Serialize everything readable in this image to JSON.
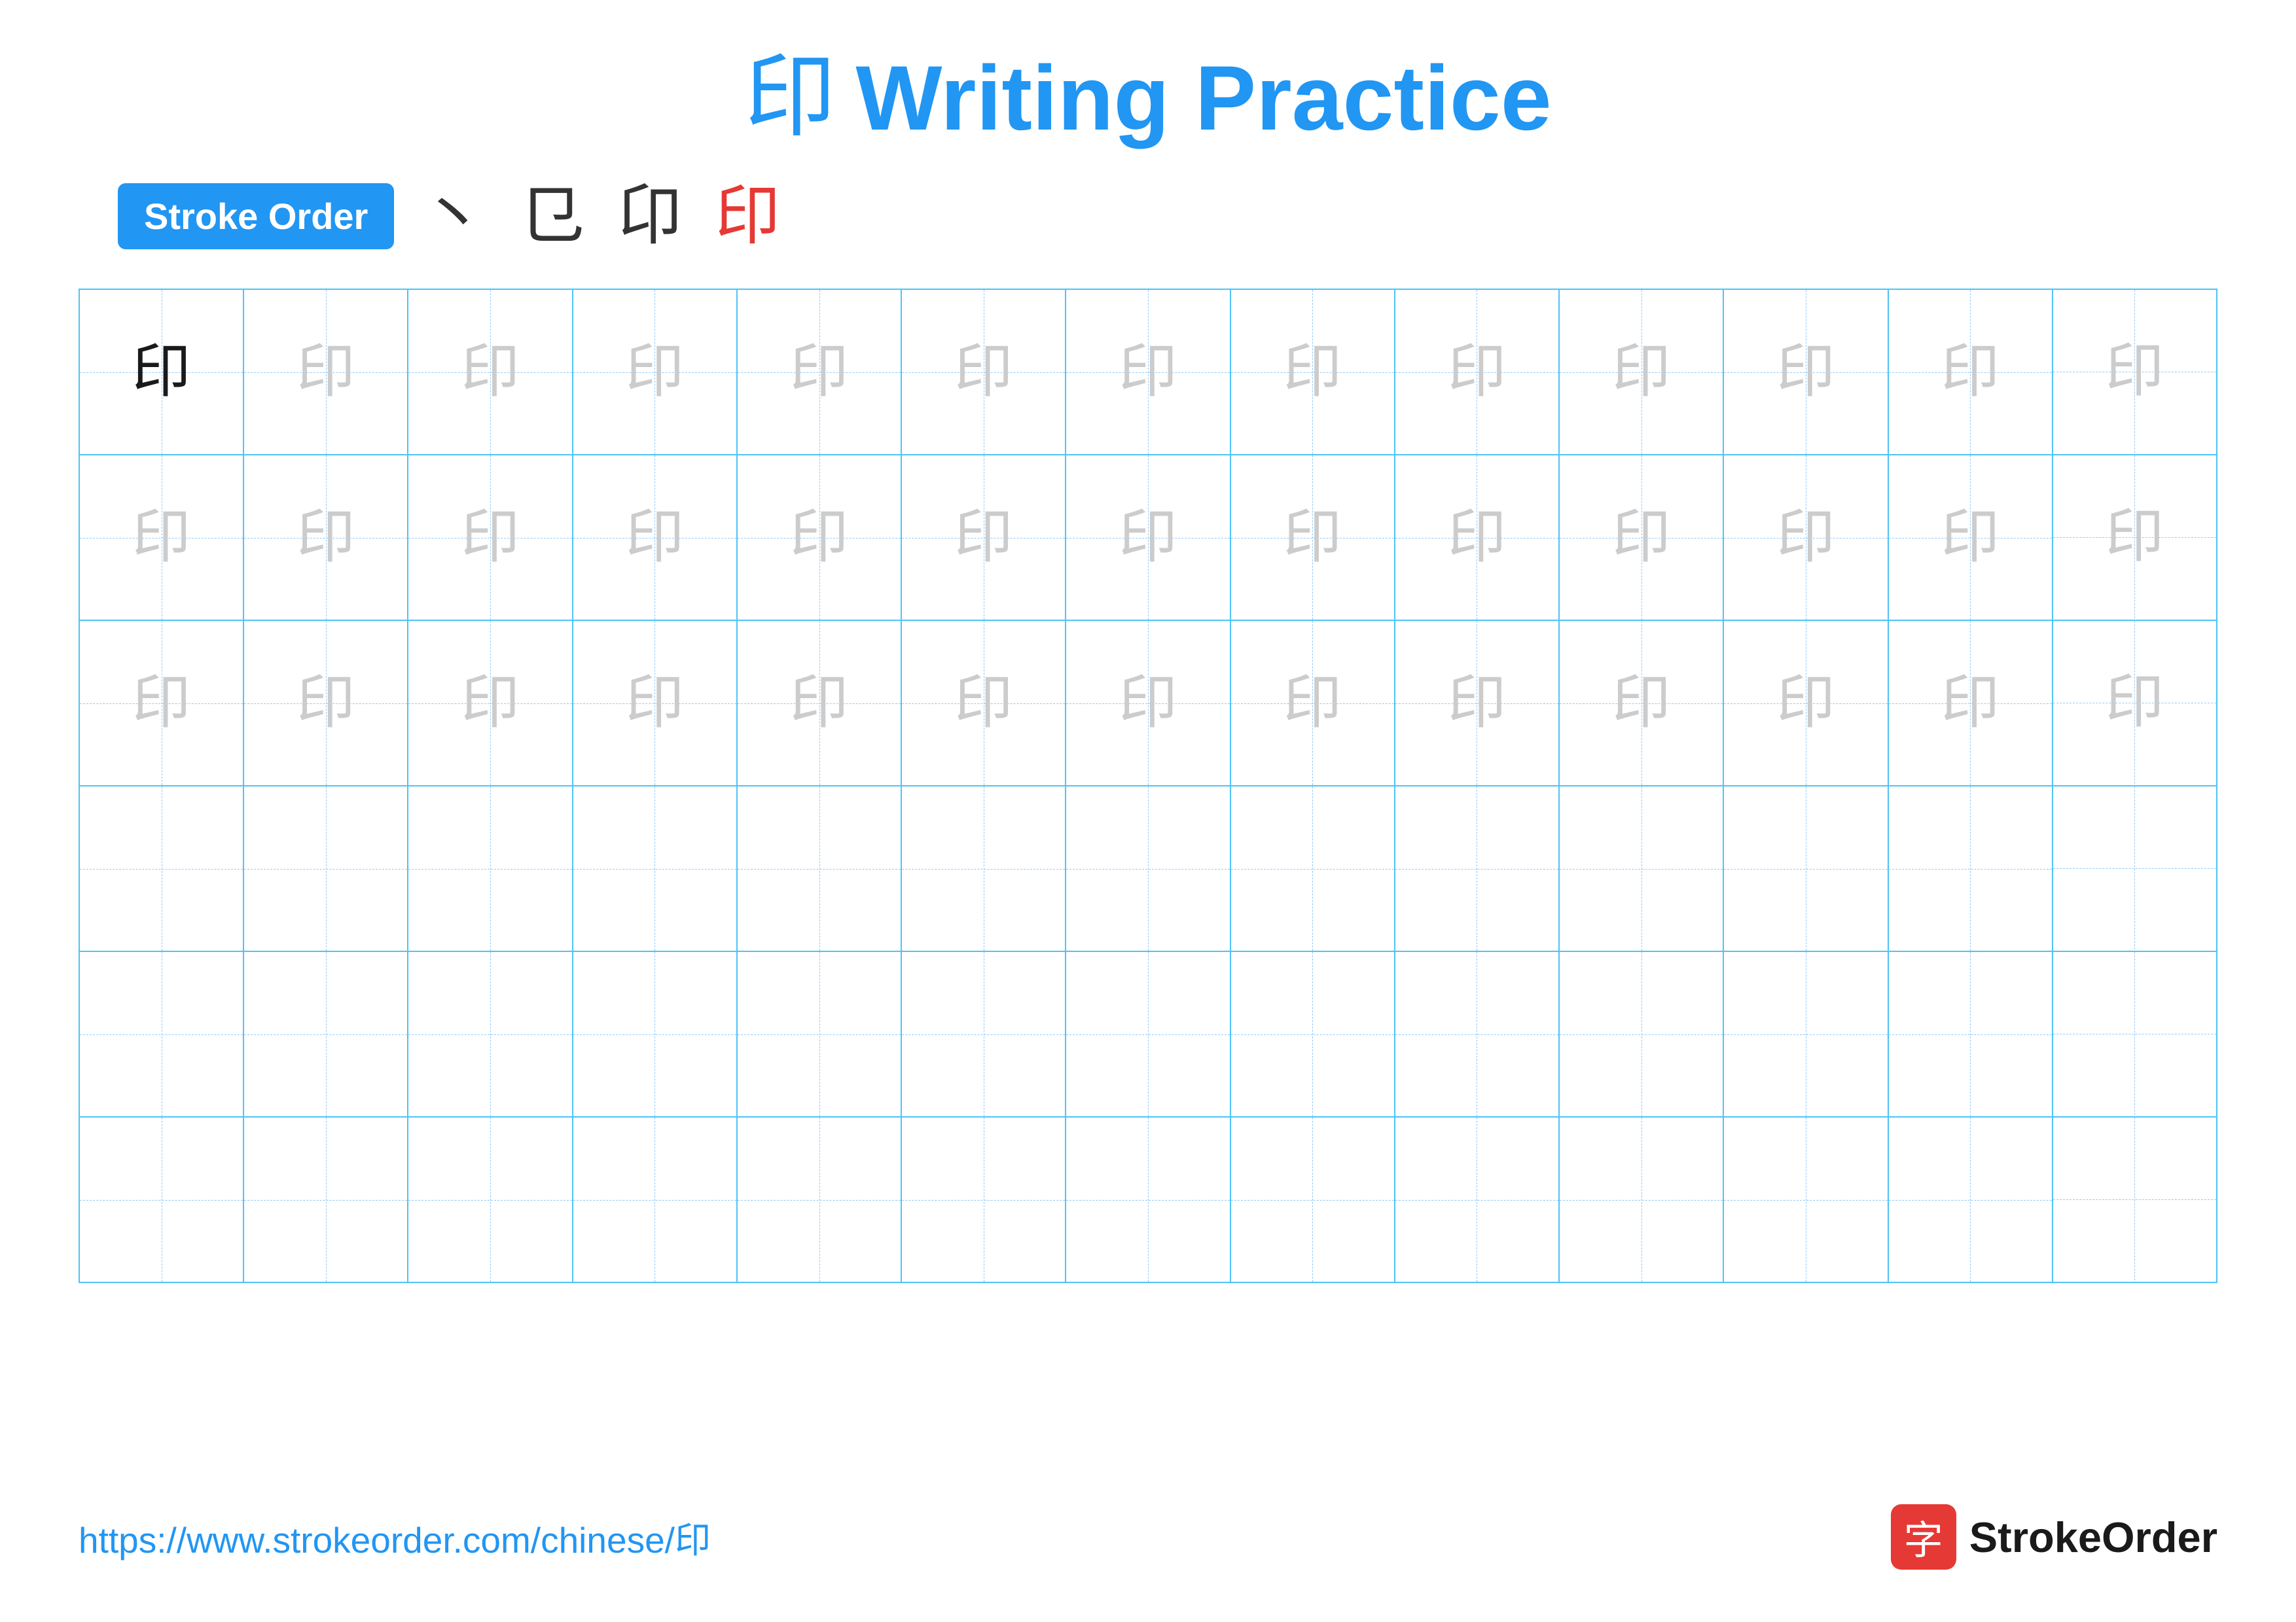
{
  "title": {
    "chinese_char": "印",
    "writing_practice_label": "Writing Practice"
  },
  "stroke_order": {
    "badge_label": "Stroke Order",
    "steps": [
      {
        "char": "丶",
        "color": "dark",
        "step": 1
      },
      {
        "char": "㔾",
        "color": "dark",
        "step": 2
      },
      {
        "char": "卬",
        "color": "dark",
        "step": 3
      },
      {
        "char": "印",
        "color": "red",
        "step": 4
      }
    ]
  },
  "grid": {
    "rows": 6,
    "cols": 13,
    "character": "印",
    "filled_rows": 3,
    "first_cell_dark": true
  },
  "footer": {
    "url": "https://www.strokeorder.com/chinese/印",
    "logo_char": "字",
    "logo_name": "StrokeOrder"
  }
}
